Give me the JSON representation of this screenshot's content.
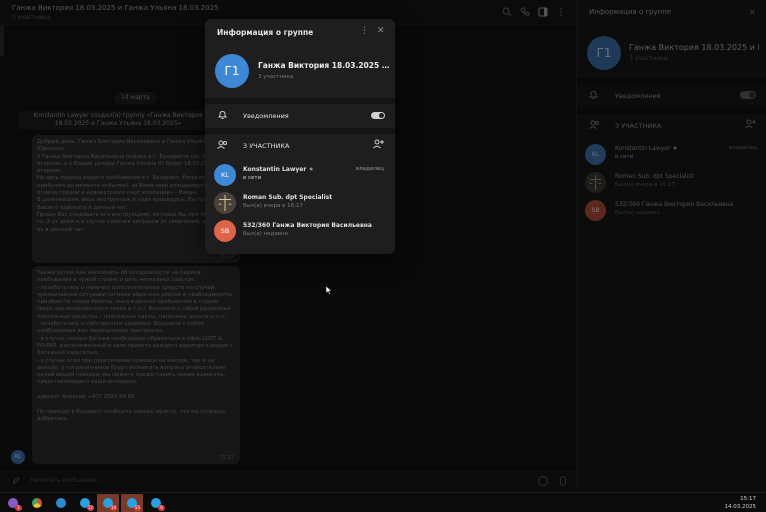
{
  "chat": {
    "title": "Ганжа Виктория 18.03.2025 и Ганжа Ульяна 18.03.2025",
    "subtitle": "3 участника",
    "date_pill": "14 марта",
    "service_message": "Konstantin Lawyer создал(а) группу «Ганжа Виктория 18.03.2025 и Ганжа Ульяна 18.03.2025»",
    "message1": {
      "text": "Добрый день, Ганжа Виктория Васильевна и Ганжа Ульяна Юрьевна!\nУ Ганжа Виктория Васильевна подана в г. Бухаресте сос 18.03.2025, вторник, и у Вашей дочери Ганжа Ульяна Ю будет 18.03.2025, вторник.\nНа весь период вашего пребывания в г. Бухарест, Румы момента прибытия до момента отбытия), за Вами закр специалист/адвокат отдела подачи и адвокатского парт компании» - Роман.\nВ дальнейшем, весь инструктаж о ходе процедуры, Вы получать от Вашего адвоката в данный чат.\nПрошу Вас следовать его инструкциям, которые Вы пол течении 1-го, 2-ух дней и в случае наличия вопросов ух замечаний, озвучивать их в данный чат.",
      "time": "15:17"
    },
    "message2": {
      "text": "Также хотим вам напомнить об осторожности на период пребывания в чужой стране и дать несколько советов:\n- позаботьтесь о наличии дополнительных средств на случай чрезвычайной ситуации (отмена обратных рейсов и необходимость приобрести новые билеты, вынужденное пребывание в стране сверх запланированного срока и т.п.); Возьмите с собой различные платежные средства – платежные карты, наличные деньги и т.п.;\n- позаботьтесь о собственном здоровье. Возьмите с собой необходимые вам медицинские препараты;\n- в случае потери багажа необходимо обратиться в офис LOST & FOUND, расположенный в зале прилета каждого аэропорта рядом с багажной каруселью.\n- в случае если при пересечении границы на въезде, так и на выезде, у пограничников будут возникать вопросы относительно целей вашей поездки, вы можете предоставить номер адвоката, представляющего ваши интересы:\n\nадвокат Алексей +407 2023 89 86\n\nПо приезду в Бухарест сообщите своему юристу, что вы успешно добрались.",
      "time": "15:17"
    },
    "sender_avatar": "KL",
    "composer_placeholder": "Написать сообщение..."
  },
  "right_panel": {
    "title": "Информация о группе",
    "avatar": "Г1",
    "name": "Ганжа Виктория 18.03.2025 и Г...",
    "count": "3 участника",
    "notifications_label": "Уведомления",
    "members_header": "3 УЧАСТНИКА",
    "members": [
      {
        "avatar": "KL",
        "name": "Konstantin Lawyer",
        "status": "в сети",
        "role": "владелец",
        "color": "#3e6ea8"
      },
      {
        "avatar": "",
        "name": "Roman Sub. dpt Specialist",
        "status": "был(а) вчера в 16:17",
        "role": "",
        "color": "#6a5a4a"
      },
      {
        "avatar": "SB",
        "name": "532/360 Ганжа Виктория Васильевна",
        "status": "был(а) недавно",
        "role": "",
        "color": "#c0553e"
      }
    ]
  },
  "modal": {
    "title": "Информация о группе",
    "avatar": "Г1",
    "name": "Ганжа Виктория 18.03.2025 и Г...",
    "count": "3 участника",
    "notifications_label": "Уведомления",
    "members_header": "3 УЧАСТНИКА",
    "members": [
      {
        "avatar": "KL",
        "name": "Konstantin Lawyer",
        "status": "в сети",
        "role": "владелец",
        "color": "#3f88d6"
      },
      {
        "avatar": "",
        "name": "Roman Sub. dpt Specialist",
        "status": "был(а) вчера в 16:17",
        "role": "",
        "color": "#7a6a58"
      },
      {
        "avatar": "SB",
        "name": "532/360 Ганжа Виктория Васильевна",
        "status": "был(а) недавно",
        "role": "",
        "color": "#e0644a"
      }
    ]
  },
  "taskbar": {
    "time": "15:17",
    "date": "14.03.2025",
    "items": [
      {
        "icon": "store-icon",
        "color": "#8a5ac8",
        "badge": "1"
      },
      {
        "icon": "chrome-icon",
        "color": "#e0b030",
        "badge": ""
      },
      {
        "icon": "edge-icon",
        "color": "#2a8ad0",
        "badge": ""
      },
      {
        "icon": "telegram-icon",
        "color": "#2aa0e0",
        "badge": "12"
      },
      {
        "icon": "telegram-icon",
        "color": "#2aa0e0",
        "badge": "14"
      },
      {
        "icon": "telegram-icon",
        "color": "#2aa0e0",
        "badge": "55"
      },
      {
        "icon": "telegram-icon",
        "color": "#2aa0e0",
        "badge": "6"
      }
    ]
  }
}
